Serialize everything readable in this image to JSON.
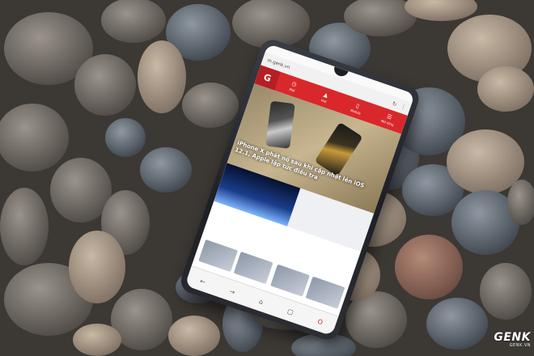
{
  "browser": {
    "url": "m.genk.vn",
    "reload_icon": "reload-icon",
    "menu_icon": "more-vert-icon"
  },
  "site_nav": {
    "logo": "G",
    "items": [
      {
        "label": "Mới",
        "icon": "clock-icon"
      },
      {
        "label": "Hot",
        "icon": "fire-icon"
      },
      {
        "label": "Mobile",
        "icon": "phone-icon"
      },
      {
        "label": "Mở rộng",
        "icon": "menu-icon"
      }
    ]
  },
  "article": {
    "headline": "iPhone X phát nổ sau khi cập nhật lên iOS 12.1, Apple lập tức điều tra"
  },
  "colors": {
    "brand_red": "#d9282c",
    "background_stones": "#5b5550"
  },
  "watermark": {
    "main": "GENK",
    "sub": "GENK.VN"
  }
}
